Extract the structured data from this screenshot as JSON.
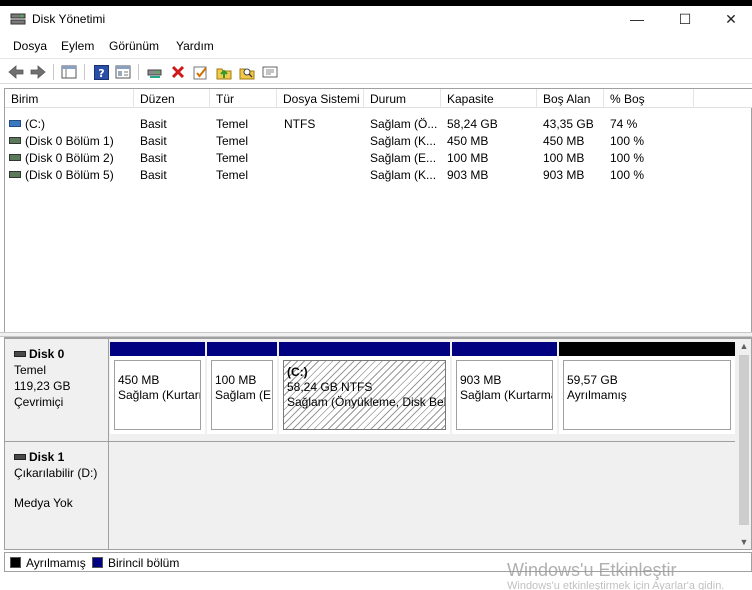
{
  "window": {
    "title": "Disk Yönetimi",
    "minimize": "—",
    "maximize": "☐",
    "close": "✕"
  },
  "menu": [
    "Dosya",
    "Eylem",
    "Görünüm",
    "Yardım"
  ],
  "toolbar": {
    "icons": [
      "back-arrow-icon",
      "forward-arrow-icon",
      "disk-list-icon",
      "help-icon",
      "properties-icon",
      "connect-drive-icon",
      "delete-icon",
      "check-icon",
      "folder-up-icon",
      "search-folder-icon",
      "settings-panel-icon"
    ]
  },
  "table": {
    "columns": [
      "Birim",
      "Düzen",
      "Tür",
      "Dosya Sistemi",
      "Durum",
      "Kapasite",
      "Boş Alan",
      "% Boş"
    ],
    "rows": [
      {
        "volume": "(C:)",
        "layout": "Basit",
        "type": "Temel",
        "fs": "NTFS",
        "status": "Sağlam (Ö...",
        "capacity": "58,24 GB",
        "free": "43,35 GB",
        "pct": "74 %"
      },
      {
        "volume": "(Disk 0 Bölüm 1)",
        "layout": "Basit",
        "type": "Temel",
        "fs": "",
        "status": "Sağlam (K...",
        "capacity": "450 MB",
        "free": "450 MB",
        "pct": "100 %"
      },
      {
        "volume": "(Disk 0 Bölüm 2)",
        "layout": "Basit",
        "type": "Temel",
        "fs": "",
        "status": "Sağlam (E...",
        "capacity": "100 MB",
        "free": "100 MB",
        "pct": "100 %"
      },
      {
        "volume": "(Disk 0 Bölüm 5)",
        "layout": "Basit",
        "type": "Temel",
        "fs": "",
        "status": "Sağlam (K...",
        "capacity": "903 MB",
        "free": "903 MB",
        "pct": "100 %"
      }
    ]
  },
  "disks": [
    {
      "name": "Disk 0",
      "kind": "Temel",
      "size": "119,23 GB",
      "state": "Çevrimiçi",
      "partitions": [
        {
          "title": "",
          "line1": "450 MB",
          "line2": "Sağlam (Kurtarma Bölümü)",
          "bar": "#000080"
        },
        {
          "title": "",
          "line1": "100 MB",
          "line2": "Sağlam (EFI Sistem Bölümü)",
          "bar": "#000080"
        },
        {
          "title": "(C:)",
          "line1": "58,24 GB NTFS",
          "line2": "Sağlam (Önyükleme, Disk Belleği Dosyası)",
          "bar": "#000080"
        },
        {
          "title": "",
          "line1": "903 MB",
          "line2": "Sağlam (Kurtarma Bölümü)",
          "bar": "#000080"
        },
        {
          "title": "",
          "line1": "59,57 GB",
          "line2": "Ayrılmamış",
          "bar": "#000000"
        }
      ]
    },
    {
      "name": "Disk 1",
      "kind": "Çıkarılabilir (D:)",
      "state": "Medya Yok"
    }
  ],
  "legend": [
    {
      "label": "Ayrılmamış",
      "color": "#000000"
    },
    {
      "label": "Birincil bölüm",
      "color": "#000080"
    }
  ],
  "watermark": {
    "line1": "Windows'u Etkinleştir",
    "line2": "Windows'u etkinleştirmek için Ayarlar'a gidin."
  }
}
